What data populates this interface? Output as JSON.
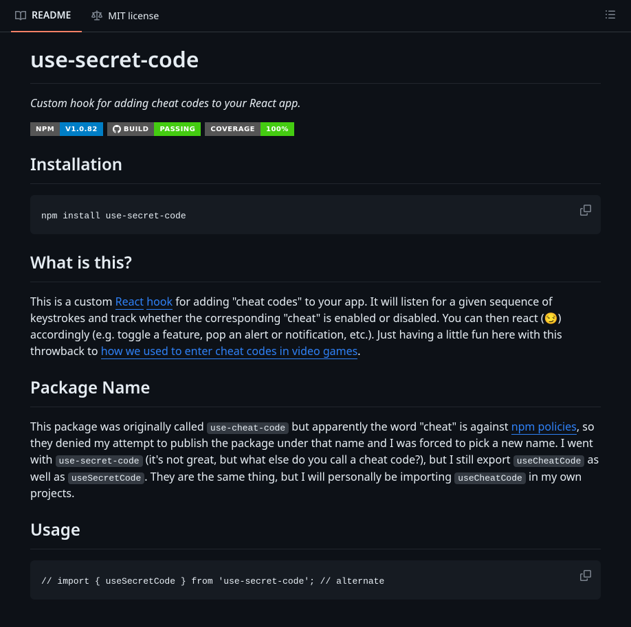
{
  "tabs": {
    "readme": "README",
    "license": "MIT license"
  },
  "title": "use-secret-code",
  "subtitle": "Custom hook for adding cheat codes to your React app.",
  "badges": {
    "npm": {
      "left": "NPM",
      "right": "V1.0.82"
    },
    "build": {
      "left": "BUILD",
      "right": "PASSING"
    },
    "coverage": {
      "left": "COVERAGE",
      "right": "100%"
    }
  },
  "sections": {
    "installation": {
      "heading": "Installation",
      "code": "npm install use-secret-code"
    },
    "what": {
      "heading": "What is this?",
      "p_a": "This is a custom ",
      "link_react": "React",
      "space": " ",
      "link_hook": "hook",
      "p_b": " for adding \"cheat codes\" to your app. It will listen for a given sequence of keystrokes and track whether the corresponding \"cheat\" is enabled or disabled. You can then react (😏) accordingly (e.g. toggle a feature, pop an alert or notification, etc.). Just having a little fun here with this throwback to ",
      "link_cheat": "how we used to enter cheat codes in video games",
      "p_c": "."
    },
    "package": {
      "heading": "Package Name",
      "p_a": "This package was originally called ",
      "code1": "use-cheat-code",
      "p_b": " but apparently the word \"cheat\" is against ",
      "link_npm": "npm policies",
      "p_c": ", so they denied my attempt to publish the package under that name and I was forced to pick a new name. I went with ",
      "code2": "use-secret-code",
      "p_d": " (it's not great, but what else do you call a cheat code?), but I still export ",
      "code3": "useCheatCode",
      "p_e": " as well as ",
      "code4": "useSecretCode",
      "p_f": ". They are the same thing, but I will personally be importing ",
      "code5": "useCheatCode",
      "p_g": " in my own projects."
    },
    "usage": {
      "heading": "Usage",
      "code": "// import { useSecretCode } from 'use-secret-code'; // alternate"
    }
  }
}
